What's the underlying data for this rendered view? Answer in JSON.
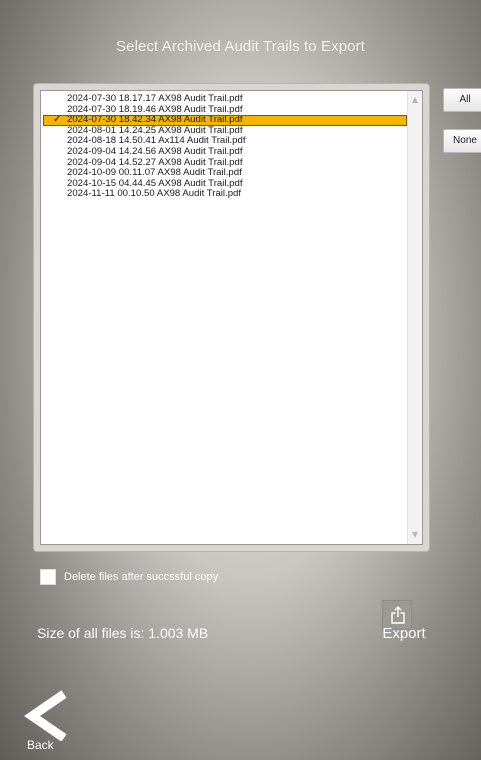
{
  "title": "Select Archived Audit Trails to Export",
  "files": [
    {
      "name": "2024-07-30 18.17.17 AX98 Audit Trail.pdf",
      "selected": false
    },
    {
      "name": "2024-07-30 18.19.46 AX98 Audit Trail.pdf",
      "selected": false
    },
    {
      "name": "2024-07-30 18.42.34 AX98 Audit Trail.pdf",
      "selected": true
    },
    {
      "name": "2024-08-01 14.24.25 AX98 Audit Trail.pdf",
      "selected": false
    },
    {
      "name": "2024-08-18 14.50.41 Ax114 Audit Trail.pdf",
      "selected": false
    },
    {
      "name": "2024-09-04 14.24.56 AX98 Audit Trail.pdf",
      "selected": false
    },
    {
      "name": "2024-09-04 14.52.27 AX98 Audit Trail.pdf",
      "selected": false
    },
    {
      "name": "2024-10-09 00.11.07 AX98 Audit Trail.pdf",
      "selected": false
    },
    {
      "name": "2024-10-15 04.44.45 AX98 Audit Trail.pdf",
      "selected": false
    },
    {
      "name": "2024-11-11 00.10.50 AX98 Audit Trail.pdf",
      "selected": false
    }
  ],
  "check_mark": "✓",
  "buttons": {
    "all": "All",
    "none": "None",
    "export": "Export",
    "back": "Back"
  },
  "delete_label": "Delete files after succssful copy",
  "delete_checked": false,
  "size_text": "Size of all files is: 1.003 MB",
  "icons": {
    "export": "share-export-icon",
    "back": "chevron-left-icon",
    "scroll_up": "triangle-up-icon",
    "scroll_down": "triangle-down-icon"
  },
  "colors": {
    "selection": "#f5b400",
    "text_light": "#ffffff",
    "list_bg": "#ffffff"
  }
}
